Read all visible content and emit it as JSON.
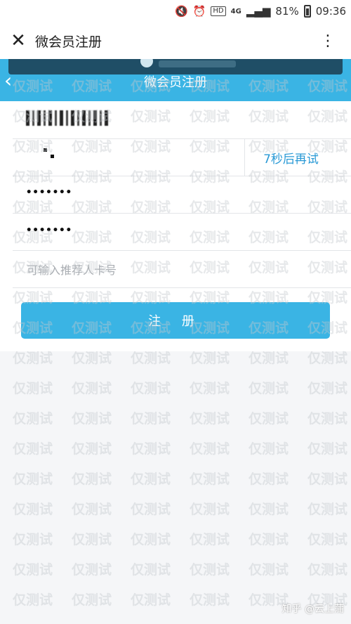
{
  "status_bar": {
    "battery": "81%",
    "time": "09:36",
    "network": "4G",
    "hd": "HD"
  },
  "app_header": {
    "title": "微会员注册",
    "more": "⋮"
  },
  "web_header": {
    "title": "微会员注册"
  },
  "form": {
    "code_button": "7秒后再试",
    "password_mask": "•••••••",
    "confirm_mask": "•••••••",
    "referral_placeholder": "可输入推荐人卡号",
    "submit_label": "注 册"
  },
  "watermark": {
    "text": "仅测试"
  },
  "footer": {
    "credit": "知乎 @云上蒲"
  },
  "colors": {
    "accent": "#3ab4e4",
    "countdown_text": "#2a9ad6",
    "banner_dark": "#1f4e66"
  }
}
